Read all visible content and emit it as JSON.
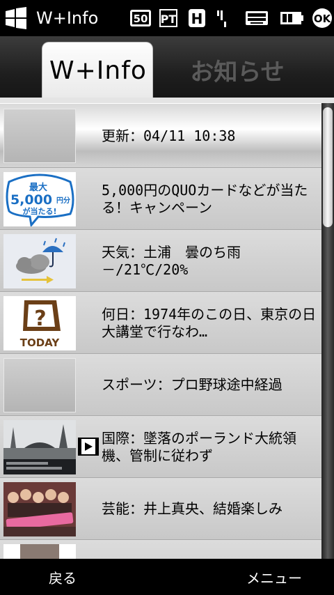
{
  "status_bar": {
    "app_title": "W+Info",
    "icons": [
      "start-logo",
      "network-icon",
      "pt-icon",
      "h-icon",
      "signal-icon",
      "keyboard-icon",
      "battery-icon",
      "ok-button"
    ],
    "ok_label": "OK",
    "pt_label": "PT",
    "h_label": "H",
    "net_label": "50"
  },
  "tabs": [
    {
      "label": "W+Info",
      "active": true
    },
    {
      "label": "お知らせ",
      "active": false
    }
  ],
  "list": {
    "header": {
      "label": "更新：04/11 10:38"
    },
    "items": [
      {
        "text": "5,000円のQUOカードなどが当たる！キャンペーン",
        "thumb": "quo-campaign-image",
        "thumb_lines": [
          "最大",
          "5,000",
          "円分",
          "が当たる!"
        ]
      },
      {
        "text": "天気：土浦　曇のち雨　－/21℃/20%",
        "thumb": "weather-cloud-umbrella-icon"
      },
      {
        "text": "何日：1974年のこの日、東京の日大講堂で行なわ…",
        "thumb": "today-icon",
        "thumb_label": "TODAY"
      },
      {
        "text": "スポーツ：プロ野球途中経過",
        "thumb": "placeholder"
      },
      {
        "text": "国際：墜落のポーランド大統領機、管制に従わず",
        "thumb": "news-photo-plane-crash",
        "video": true
      },
      {
        "text": "芸能：井上真央、結婚楽しみ",
        "thumb": "photo-group-event"
      },
      {
        "text": "",
        "thumb": "photo-partial"
      }
    ]
  },
  "softkeys": {
    "left": "戻る",
    "right": "メニュー"
  },
  "colors": {
    "weather_blue": "#2a6fc0",
    "today_brown": "#6b3f17",
    "quo_blue": "#1a6fc4"
  }
}
